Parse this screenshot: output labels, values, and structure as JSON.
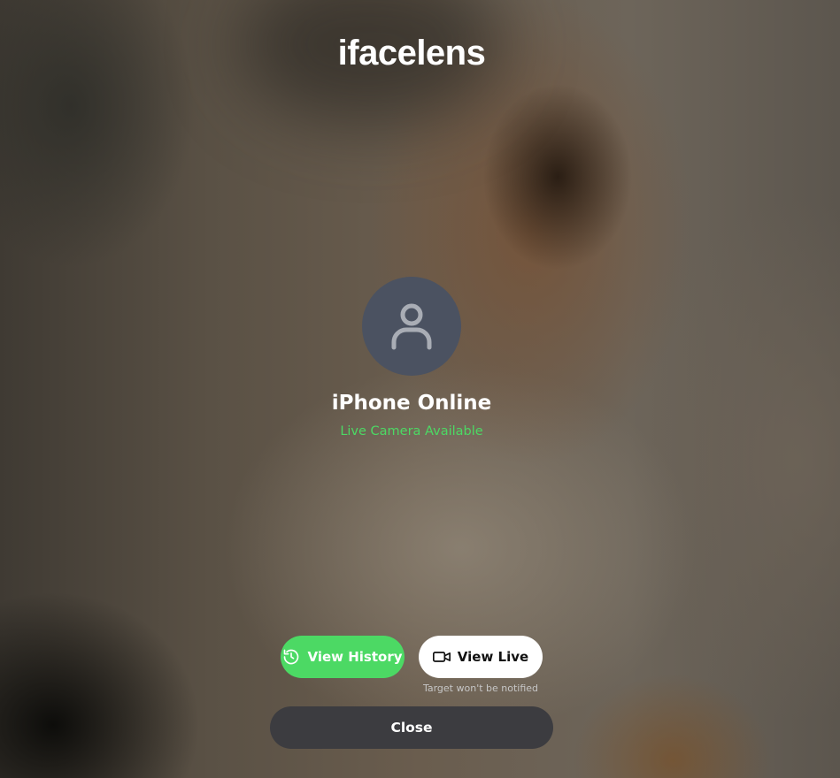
{
  "app": {
    "title": "ifacelens"
  },
  "profile": {
    "avatar_icon": "user-icon",
    "device_name": "iPhone Online",
    "status": "Live Camera Available"
  },
  "actions": {
    "history_label": "View History",
    "history_icon": "history-icon",
    "live_label": "View Live",
    "live_icon": "video-camera-icon",
    "live_note": "Target won't be notified",
    "close_label": "Close"
  },
  "colors": {
    "accent_green": "#4cd964",
    "avatar_bg": "#4b5261",
    "close_bg": "#3c3c40"
  }
}
